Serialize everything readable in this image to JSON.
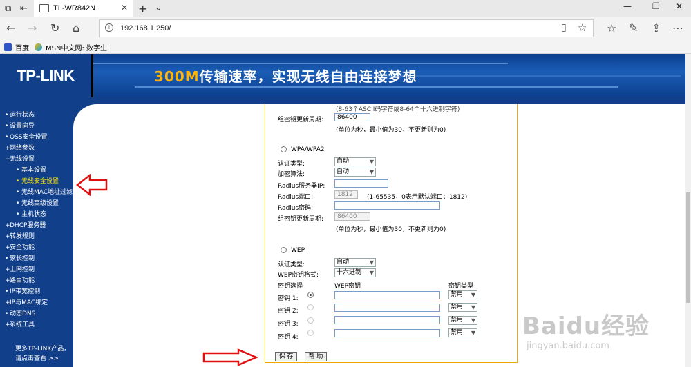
{
  "browser": {
    "tab_title": "TL-WR842N",
    "url": "192.168.1.250/",
    "favorites": [
      {
        "label": "百度"
      },
      {
        "label": "MSN中文网: 数字生"
      }
    ]
  },
  "banner": {
    "logo": "TP-LINK",
    "slogan_highlight": "300M",
    "slogan_rest": "传输速率，实现无线自由连接梦想"
  },
  "sidebar": {
    "items": [
      {
        "label": "运行状态",
        "marker": "•"
      },
      {
        "label": "设置向导",
        "marker": "•"
      },
      {
        "label": "QSS安全设置",
        "marker": "•"
      },
      {
        "label": "网络参数",
        "marker": "+"
      },
      {
        "label": "无线设置",
        "marker": "−"
      },
      {
        "label": "基本设置",
        "marker": "•",
        "sub": true
      },
      {
        "label": "无线安全设置",
        "marker": "•",
        "sub": true,
        "active": true
      },
      {
        "label": "无线MAC地址过滤",
        "marker": "•",
        "sub": true
      },
      {
        "label": "无线高级设置",
        "marker": "•",
        "sub": true
      },
      {
        "label": "主机状态",
        "marker": "•",
        "sub": true
      },
      {
        "label": "DHCP服务器",
        "marker": "+"
      },
      {
        "label": "转发规则",
        "marker": "+"
      },
      {
        "label": "安全功能",
        "marker": "+"
      },
      {
        "label": "家长控制",
        "marker": "•"
      },
      {
        "label": "上网控制",
        "marker": "+"
      },
      {
        "label": "路由功能",
        "marker": "+"
      },
      {
        "label": "IP带宽控制",
        "marker": "•"
      },
      {
        "label": "IP与MAC绑定",
        "marker": "+"
      },
      {
        "label": "动态DNS",
        "marker": "•"
      },
      {
        "label": "系统工具",
        "marker": "+"
      }
    ],
    "more_line1": "更多TP-LINK产品，",
    "more_line2": "请点击查看 >>"
  },
  "form": {
    "psk_hint": "(8-63个ASCII码字符或8-64个十六进制字符)",
    "psk_group_key_label": "组密钥更新周期:",
    "psk_group_key_value": "86400",
    "psk_group_key_hint": "(单位为秒，最小值为30，不更新则为0)",
    "wpa_title": "WPA/WPA2",
    "wpa_auth_label": "认证类型:",
    "wpa_auth_value": "自动",
    "wpa_enc_label": "加密算法:",
    "wpa_enc_value": "自动",
    "radius_ip_label": "Radius服务器IP:",
    "radius_ip_value": "",
    "radius_port_label": "Radius端口:",
    "radius_port_value": "1812",
    "radius_port_hint": "(1-65535，0表示默认端口：1812)",
    "radius_pwd_label": "Radius密码:",
    "radius_pwd_value": "",
    "wpa_group_key_label": "组密钥更新周期:",
    "wpa_group_key_value": "86400",
    "wpa_group_key_hint": "(单位为秒，最小值为30，不更新则为0)",
    "wep_title": "WEP",
    "wep_auth_label": "认证类型:",
    "wep_auth_value": "自动",
    "wep_format_label": "WEP密钥格式:",
    "wep_format_value": "十六进制",
    "col_key_select": "密钥选择",
    "col_wep_key": "WEP密钥",
    "col_key_type": "密钥类型",
    "keys": [
      {
        "label": "密钥 1:",
        "value": "",
        "type": "禁用"
      },
      {
        "label": "密钥 2:",
        "value": "",
        "type": "禁用"
      },
      {
        "label": "密钥 3:",
        "value": "",
        "type": "禁用"
      },
      {
        "label": "密钥 4:",
        "value": "",
        "type": "禁用"
      }
    ],
    "save_label": "保 存",
    "help_label": "帮 助"
  },
  "watermark": {
    "big": "Baidu经验",
    "small": "jingyan.baidu.com"
  },
  "colors": {
    "sidebar": "#123f8a",
    "active_menu": "#ffe400",
    "panel_border": "#f0a800",
    "arrow": "#e01010"
  }
}
